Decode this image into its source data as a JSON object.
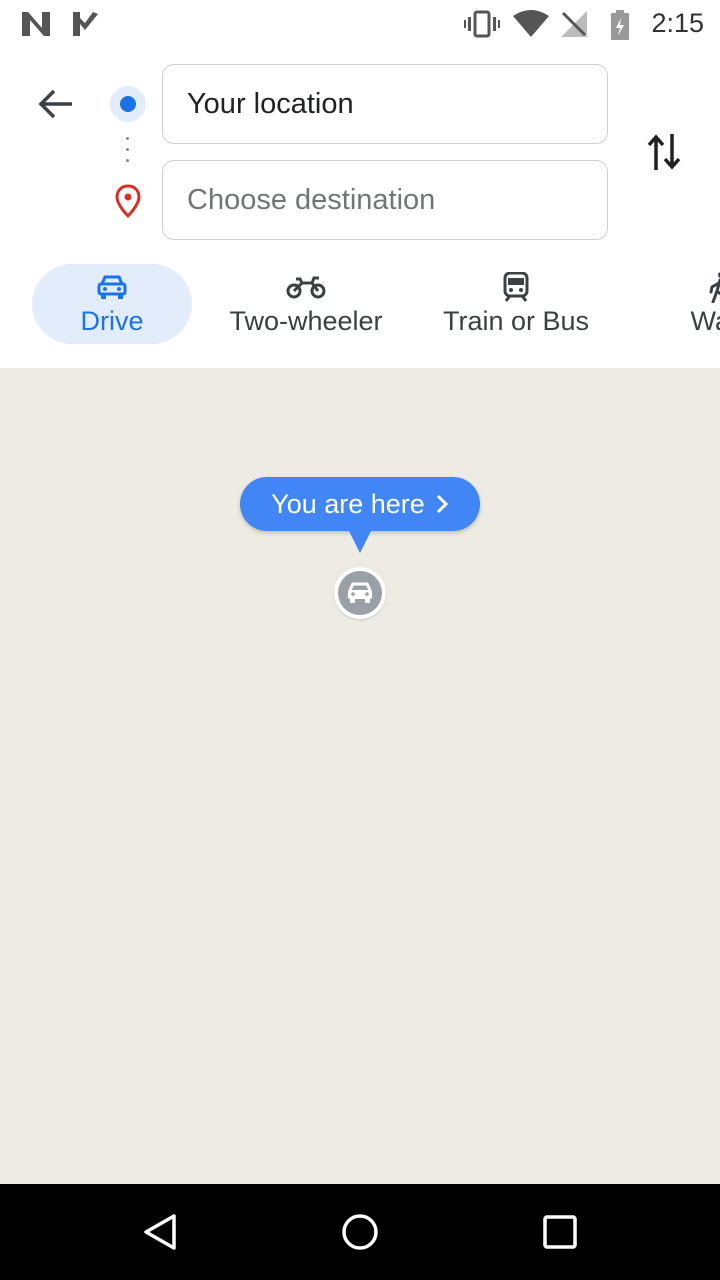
{
  "status_bar": {
    "time": "2:15",
    "left_icons": [
      "n-notification-icon",
      "check-notification-icon"
    ],
    "right_icons": [
      "vibrate-icon",
      "wifi-icon",
      "no-signal-icon",
      "battery-charging-icon"
    ]
  },
  "header": {
    "back_icon": "arrow-back-icon",
    "origin": {
      "value": "Your location"
    },
    "destination": {
      "placeholder": "Choose destination"
    },
    "swap_icon": "swap-vertical-icon"
  },
  "modes": [
    {
      "label": "Drive",
      "icon": "car-icon",
      "selected": true
    },
    {
      "label": "Two-wheeler",
      "icon": "motorcycle-icon",
      "selected": false
    },
    {
      "label": "Train or Bus",
      "icon": "train-icon",
      "selected": false
    },
    {
      "label": "Walk",
      "icon": "walk-icon",
      "selected": false
    }
  ],
  "map": {
    "bubble_label": "You are here",
    "marker_icon": "car-marker-icon"
  },
  "nav_bar": {
    "buttons": [
      "back-triangle-icon",
      "home-circle-icon",
      "recents-square-icon"
    ]
  },
  "colors": {
    "accent": "#1a73e8",
    "bubble": "#4285f4",
    "map_bg": "#eeebe5",
    "pin_red": "#d93025"
  }
}
